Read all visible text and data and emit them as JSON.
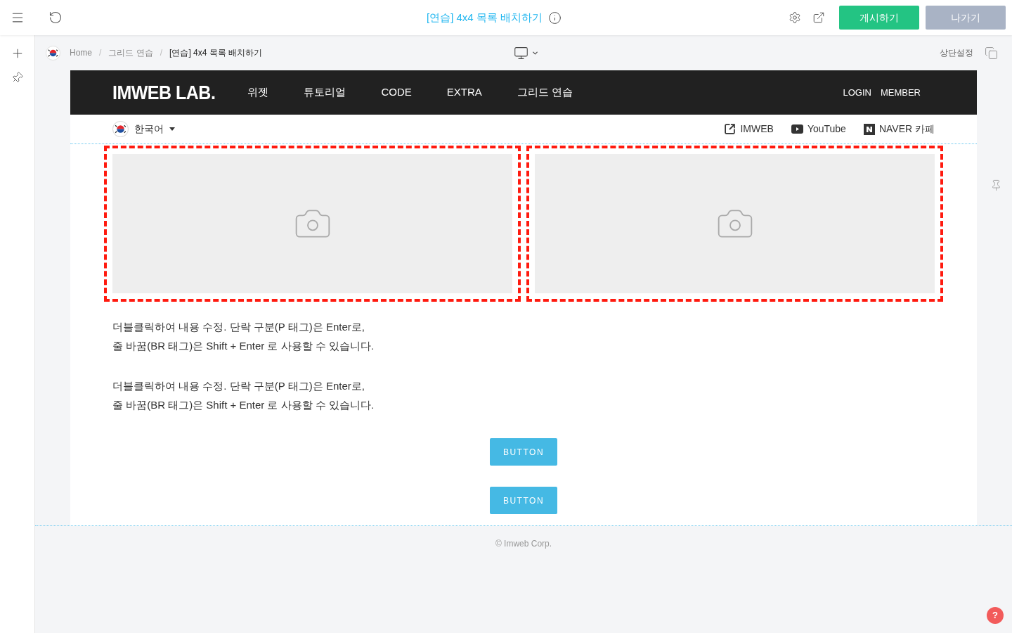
{
  "toolbar": {
    "title": "[연습] 4x4 목록 배치하기",
    "buttons": [
      {
        "label": "게시하기",
        "kind": "primary"
      },
      {
        "label": "나가기",
        "kind": "secondary"
      }
    ]
  },
  "breadcrumb": [
    "Home",
    "그리드 연습",
    "[연습] 4x4 목록 배치하기"
  ],
  "breadcrumb_separators": [
    "/",
    "/"
  ],
  "header_settings": "상단설정",
  "site": {
    "logo": "IMWEB LAB.",
    "nav": [
      "위젯",
      "튜토리얼",
      "CODE",
      "EXTRA",
      "그리드 연습"
    ],
    "account": [
      "LOGIN",
      "MEMBER"
    ],
    "language": "한국어",
    "links": [
      {
        "label": "IMWEB",
        "kind": "external"
      },
      {
        "label": "YouTube",
        "kind": "youtube"
      },
      {
        "label": "NAVER 카페",
        "kind": "naver"
      }
    ],
    "images": [
      {
        "kind": "picture",
        "selected": true
      },
      {
        "kind": "picture",
        "selected": true
      }
    ],
    "paragraphs": [
      [
        "더블클릭하여 내용 수정. 단락 구분(P 태그)은 Enter로,",
        "줄 바꿈(BR 태그)은 Shift + Enter 로 사용할 수 있습니다."
      ],
      [
        "더블클릭하여 내용 수정. 단락 구분(P 태그)은 Enter로,",
        "줄 바꿈(BR 태그)은 Shift + Enter 로 사용할 수 있습니다."
      ]
    ],
    "buttons": [
      "BUTTON",
      "BUTTON"
    ]
  },
  "footer": "© Imweb Corp.",
  "help": "?"
}
